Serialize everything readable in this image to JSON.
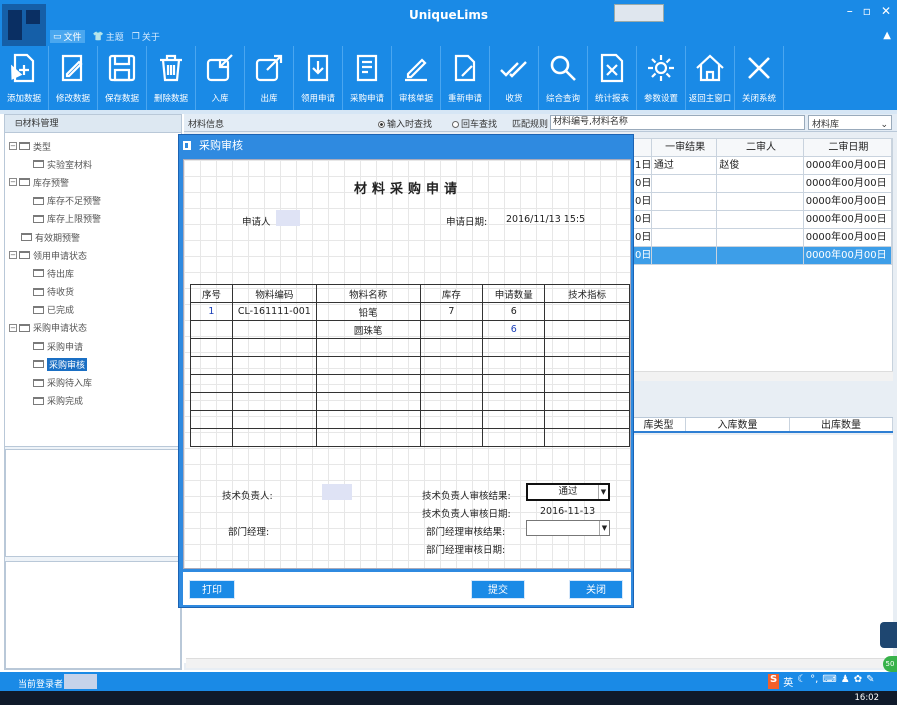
{
  "app": {
    "title": "UniqueLims",
    "menu": [
      {
        "label": "文件",
        "icon": "file-icon"
      },
      {
        "label": "主题",
        "icon": "shirt-icon"
      },
      {
        "label": "关于",
        "icon": "info-icon"
      }
    ]
  },
  "toolbar": {
    "items": [
      {
        "label": "添加数据",
        "icon": "add-document-icon"
      },
      {
        "label": "修改数据",
        "icon": "edit-document-icon"
      },
      {
        "label": "保存数据",
        "icon": "save-icon"
      },
      {
        "label": "删除数据",
        "icon": "trash-icon"
      },
      {
        "label": "入库",
        "icon": "import-icon"
      },
      {
        "label": "出库",
        "icon": "export-icon"
      },
      {
        "label": "领用申请",
        "icon": "download-doc-icon"
      },
      {
        "label": "采购申请",
        "icon": "purchase-doc-icon"
      },
      {
        "label": "审核单据",
        "icon": "pen-icon"
      },
      {
        "label": "重新申请",
        "icon": "redo-doc-icon"
      },
      {
        "label": "收货",
        "icon": "double-check-icon"
      },
      {
        "label": "综合查询",
        "icon": "search-icon"
      },
      {
        "label": "统计报表",
        "icon": "excel-icon"
      },
      {
        "label": "参数设置",
        "icon": "gear-icon"
      },
      {
        "label": "返回主窗口",
        "icon": "home-icon"
      },
      {
        "label": "关闭系统",
        "icon": "close-icon"
      }
    ]
  },
  "left_panel": {
    "title": "材料管理",
    "tree": [
      {
        "label": "类型",
        "level": 0
      },
      {
        "label": "实验室材料",
        "level": 1
      },
      {
        "label": "库存预警",
        "level": 0
      },
      {
        "label": "库存不足预警",
        "level": 1
      },
      {
        "label": "库存上限预警",
        "level": 1
      },
      {
        "label": "有效期预警",
        "level": 0
      },
      {
        "label": "领用申请状态",
        "level": 0
      },
      {
        "label": "待出库",
        "level": 1
      },
      {
        "label": "待收货",
        "level": 1
      },
      {
        "label": "已完成",
        "level": 1
      },
      {
        "label": "采购申请状态",
        "level": 0
      },
      {
        "label": "采购申请",
        "level": 1
      },
      {
        "label": "采购审核",
        "level": 1,
        "selected": true
      },
      {
        "label": "采购待入库",
        "level": 1
      },
      {
        "label": "采购完成",
        "level": 1
      }
    ]
  },
  "filter": {
    "section_label": "材料信息",
    "radio_input": "输入时查找",
    "radio_enter": "回车查找",
    "match_label": "匹配规则",
    "search_value": "材料编号,材料名称",
    "library_select": "材料库"
  },
  "top_grid": {
    "headers": [
      "",
      "一审结果",
      "二审人",
      "二审日期"
    ],
    "rows": [
      [
        "1日",
        "通过",
        "赵俊",
        "0000年00月00日"
      ],
      [
        "0日",
        "",
        "",
        "0000年00月00日"
      ],
      [
        "0日",
        "",
        "",
        "0000年00月00日"
      ],
      [
        "0日",
        "",
        "",
        "0000年00月00日"
      ],
      [
        "0日",
        "",
        "",
        "0000年00月00日"
      ],
      [
        "0日",
        "",
        "",
        "0000年00月00日"
      ]
    ]
  },
  "bottom_grid": {
    "headers": [
      "库类型",
      "入库数量",
      "出库数量"
    ]
  },
  "dialog": {
    "title": "采购审核",
    "form_title": "材料采购申请",
    "applicant_label": "申请人",
    "date_label": "申请日期:",
    "date_value": "2016/11/13 15:5",
    "table_headers": [
      "序号",
      "物料编码",
      "物料名称",
      "库存",
      "申请数量",
      "技术指标"
    ],
    "table_rows": [
      [
        "1",
        "CL-161111-001",
        "铅笔",
        "7",
        "6",
        ""
      ],
      [
        "",
        "",
        "圆珠笔",
        "",
        "6",
        ""
      ],
      [
        "",
        "",
        "",
        "",
        "",
        ""
      ],
      [
        "",
        "",
        "",
        "",
        "",
        ""
      ],
      [
        "",
        "",
        "",
        "",
        "",
        ""
      ],
      [
        "",
        "",
        "",
        "",
        "",
        ""
      ],
      [
        "",
        "",
        "",
        "",
        "",
        ""
      ],
      [
        "",
        "",
        "",
        "",
        "",
        ""
      ]
    ],
    "tech_lead_label": "技术负责人:",
    "tech_result_label": "技术负责人审核结果:",
    "tech_result_value": "通过",
    "tech_date_label": "技术负责人审核日期:",
    "tech_date_value": "2016-11-13",
    "dept_manager_label": "部门经理:",
    "dept_result_label": "部门经理审核结果:",
    "dept_result_value": "",
    "dept_date_label": "部门经理审核日期:",
    "print_button": "打印",
    "submit_button": "提交",
    "close_button": "关闭"
  },
  "status": {
    "login_label": "当前登录者",
    "ime": "英",
    "time": "16:02"
  }
}
